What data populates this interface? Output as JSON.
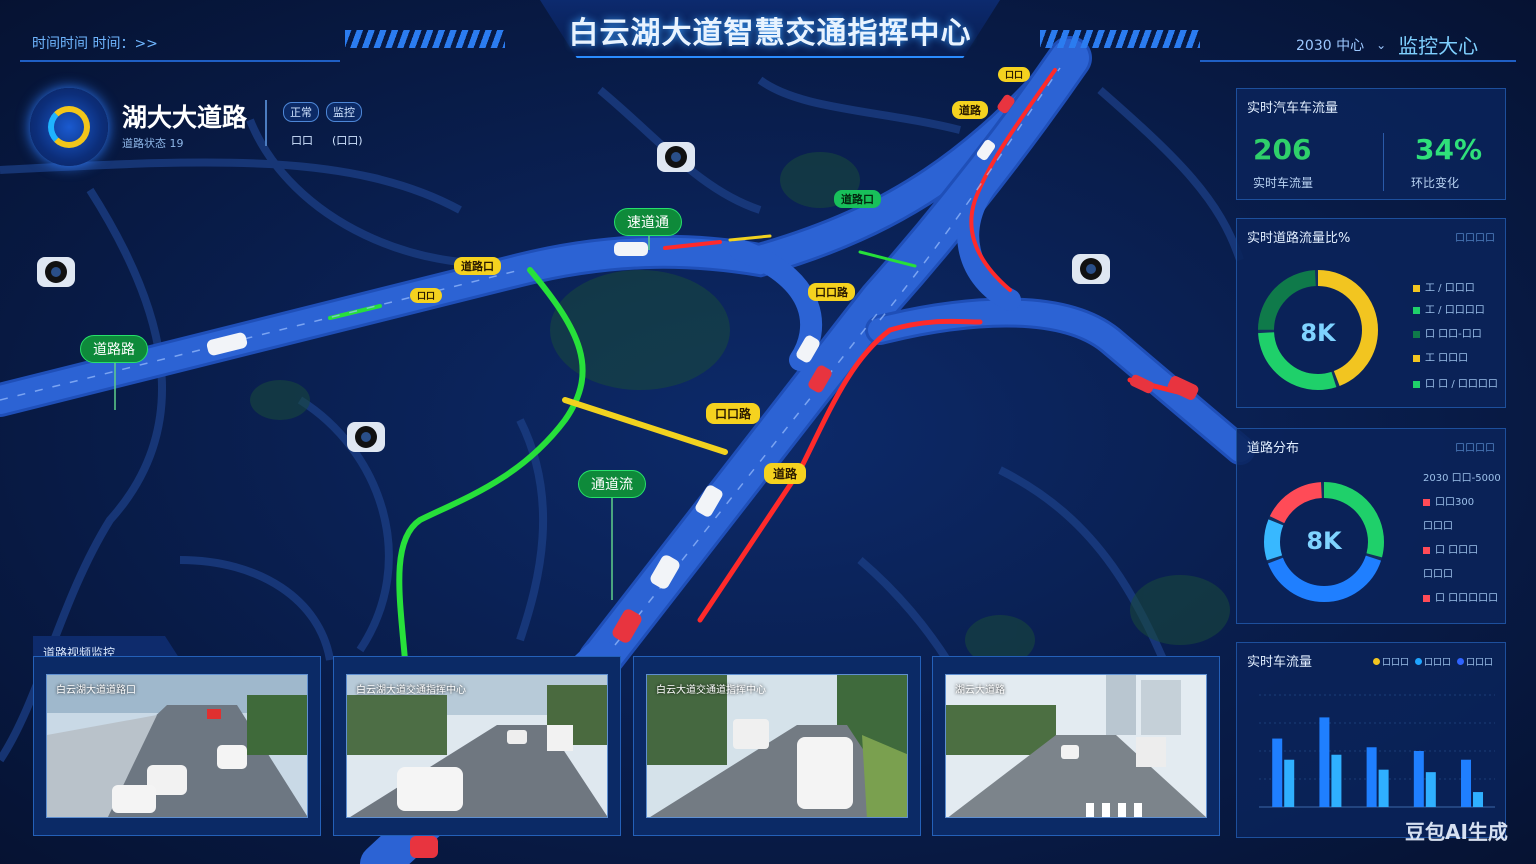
{
  "header": {
    "title": "白云湖大道智慧交通指挥中心",
    "datetime": "时间时间 时间：>>",
    "user": "2030 中心",
    "monitor_title": "监控大心"
  },
  "road": {
    "name": "湖大大道路",
    "subtitle": "道路状态   19",
    "badges": [
      "正常",
      "监控",
      "口口",
      "(口口)"
    ]
  },
  "map_labels": [
    "速道通",
    "道路路",
    "通道流"
  ],
  "map_tags": [
    "道路口",
    "口口路",
    "道路",
    "口口路",
    "道路",
    "道路口",
    "口口",
    "口口"
  ],
  "panels": {
    "realtime": {
      "title": "实时汽车车流量",
      "count": "206",
      "count_caption": "实时车流量",
      "percent": "34%",
      "percent_caption": "环比变化"
    },
    "donut1": {
      "title": "实时道路流量比%",
      "subtitle": "口口口口",
      "center": "8K",
      "legend": [
        "工 / 口口口",
        "工 / 口口口口",
        "口 口口-口口",
        "工 口口口",
        "口 口 / 口口口口"
      ],
      "colors": [
        "#f2c520",
        "#1fd06a",
        "#0f7a4a",
        "#13305f"
      ],
      "values": [
        45,
        30,
        25
      ]
    },
    "donut2": {
      "title": "道路分布",
      "subtitle": "口口口口",
      "center": "8K",
      "legend": [
        "2030 口口-5000",
        "口口300",
        "口口口",
        "口 口口口",
        "口口口",
        "口 口口口口口"
      ],
      "colors": [
        "#1fd06a",
        "#1f7fff",
        "#38b8ff",
        "#ff4b57"
      ],
      "values": [
        30,
        40,
        12,
        18
      ]
    },
    "bar": {
      "title": "实时车流量",
      "legend": [
        "口口口",
        "口口口",
        "口口口"
      ],
      "legend_colors": [
        "#f2c520",
        "#1fa5ff",
        "#2f63ff"
      ]
    }
  },
  "chart_data": {
    "type": "bar",
    "categories": [
      "",
      "",
      "",
      "",
      ""
    ],
    "series": [
      {
        "values": [
          55,
          72,
          48,
          45,
          38
        ]
      },
      {
        "values": [
          38,
          42,
          30,
          28,
          12
        ]
      }
    ],
    "ylim": [
      0,
      90
    ]
  },
  "videos": {
    "strip_title": "道路视频监控",
    "cams": [
      {
        "caption": "白云湖大道道路口"
      },
      {
        "caption": "白云湖大道交通指挥中心"
      },
      {
        "caption": "白云大道交通道指挥中心"
      },
      {
        "caption": "湖云大道路"
      }
    ]
  },
  "watermark": "豆包AI生成",
  "colors": {
    "accent": "#2a8cff",
    "good": "#1fd06a",
    "warn": "#f2c520",
    "danger": "#ff2a2a"
  }
}
